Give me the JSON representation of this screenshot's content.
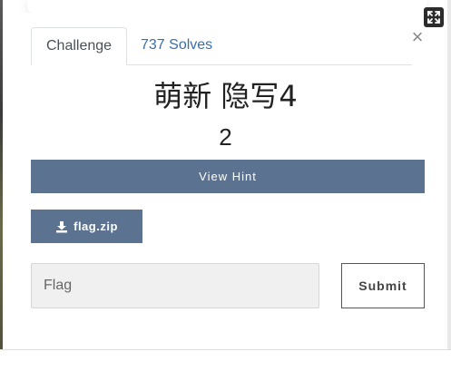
{
  "tabs": {
    "challenge_label": "Challenge",
    "solves_label": "737 Solves"
  },
  "challenge": {
    "name": "萌新 隐写4",
    "value": "2"
  },
  "buttons": {
    "hint_label": "View Hint",
    "file_label": "flag.zip",
    "submit_label": "Submit"
  },
  "flag_input": {
    "placeholder": "Flag",
    "value": ""
  },
  "icons": {
    "expand": "expand-icon",
    "close": "close-icon",
    "download": "download-icon"
  },
  "colors": {
    "button_bg": "#5b7290",
    "tab_link": "#3b6ea8"
  }
}
